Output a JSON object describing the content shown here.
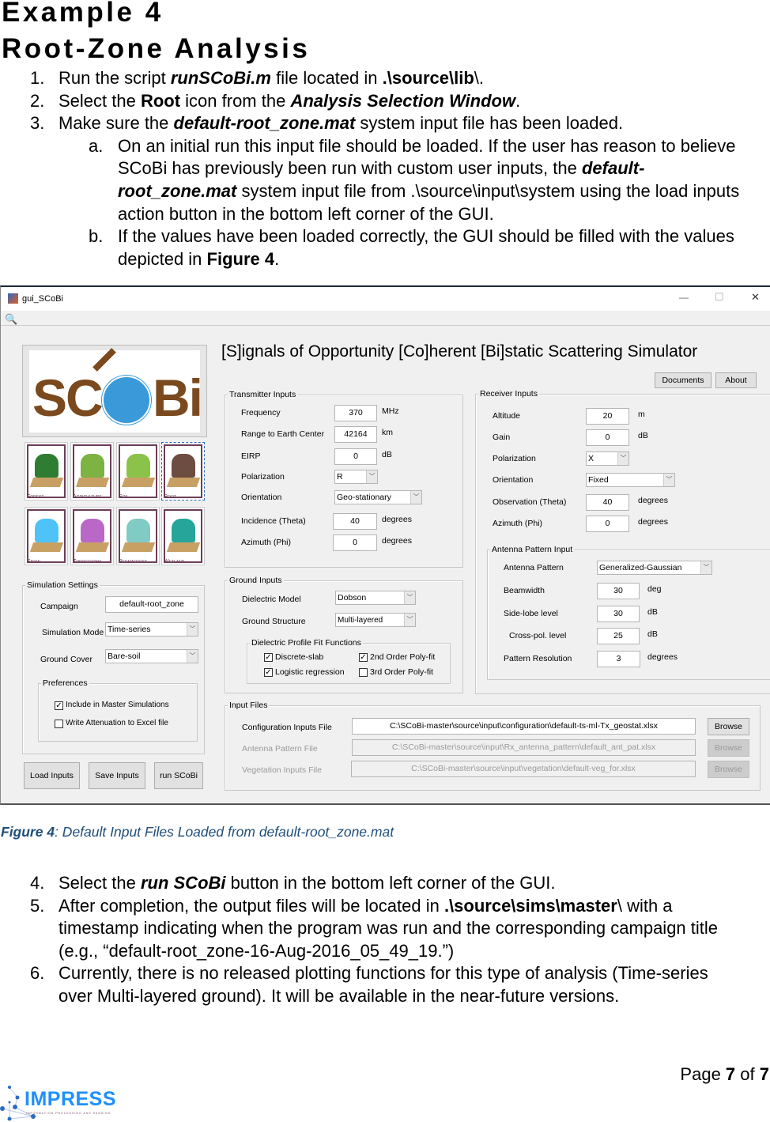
{
  "heading": {
    "line1": "Example 4",
    "line2": "Root-Zone Analysis"
  },
  "steps_top": [
    {
      "n": "1.",
      "parts": [
        "Run the script ",
        "runSCoBi.m",
        " file located in ",
        ".\\source\\lib",
        "\\."
      ]
    },
    {
      "n": "2.",
      "parts": [
        "Select the ",
        "Root",
        " icon from the ",
        "Analysis Selection Window",
        "."
      ]
    },
    {
      "n": "3.",
      "parts": [
        "Make sure the ",
        "default-root_zone.mat",
        " system input file has been loaded."
      ]
    }
  ],
  "substeps": [
    {
      "n": "a.",
      "lines": [
        "On an initial run this input file should be loaded. If the user has reason to believe",
        "SCoBi has previously been run with custom user inputs, the ",
        "default-",
        "root_zone.mat",
        " system input file from .\\source\\input\\system using the load inputs",
        "action button in the bottom left corner of the GUI."
      ]
    },
    {
      "n": "b.",
      "lines": [
        "If the values have been loaded correctly, the GUI should be filled with the values",
        "depicted in ",
        "Figure 4",
        "."
      ]
    }
  ],
  "gui": {
    "window_title": "gui_SCoBi",
    "controls": {
      "minimize": "—",
      "maximize": "☐",
      "close": "✕"
    },
    "app_title": "[S]ignals of Opportunity [Co]herent [Bi]static Scattering Simulator",
    "logo_text": "SCoBi",
    "analysis_icons": [
      "Forest",
      "Agriculture",
      "Soil",
      "Root",
      "Snow",
      "Topography",
      "Permafrost",
      "Wetland"
    ],
    "selected_icon": "Root",
    "buttons": {
      "documents": "Documents",
      "about": "About",
      "load": "Load Inputs",
      "save": "Save Inputs",
      "run": "run SCoBi",
      "browse": "Browse"
    },
    "sim": {
      "title": "Simulation Settings",
      "campaign_label": "Campaign",
      "campaign": "default-root_zone",
      "mode_label": "Simulation Mode",
      "mode": "Time-series",
      "cover_label": "Ground Cover",
      "cover": "Bare-soil",
      "pref_title": "Preferences",
      "pref1": "Include in Master Simulations",
      "pref1_checked": true,
      "pref2": "Write Attenuation to Excel file",
      "pref2_checked": false
    },
    "tx": {
      "title": "Transmitter Inputs",
      "freq_label": "Frequency",
      "freq": "370",
      "freq_unit": "MHz",
      "range_label": "Range to Earth Center",
      "range": "42164",
      "range_unit": "km",
      "eirp_label": "EIRP",
      "eirp": "0",
      "eirp_unit": "dB",
      "pol_label": "Polarization",
      "pol": "R",
      "orient_label": "Orientation",
      "orient": "Geo-stationary",
      "inc_label": "Incidence (Theta)",
      "inc": "40",
      "inc_unit": "degrees",
      "az_label": "Azimuth (Phi)",
      "az": "0",
      "az_unit": "degrees"
    },
    "ground": {
      "title": "Ground Inputs",
      "diel_label": "Dielectric Model",
      "diel": "Dobson",
      "struct_label": "Ground Structure",
      "struct": "Multi-layered",
      "fit_title": "Dielectric Profile Fit Functions",
      "fits": [
        {
          "label": "Discrete-slab",
          "checked": true
        },
        {
          "label": "2nd Order Poly-fit",
          "checked": true
        },
        {
          "label": "Logistic regression",
          "checked": true
        },
        {
          "label": "3rd Order Poly-fit",
          "checked": false
        }
      ]
    },
    "rx": {
      "title": "Receiver Inputs",
      "alt_label": "Altitude",
      "alt": "20",
      "alt_unit": "m",
      "gain_label": "Gain",
      "gain": "0",
      "gain_unit": "dB",
      "pol_label": "Polarization",
      "pol": "X",
      "orient_label": "Orientation",
      "orient": "Fixed",
      "obs_label": "Observation (Theta)",
      "obs": "40",
      "obs_unit": "degrees",
      "az_label": "Azimuth (Phi)",
      "az": "0",
      "az_unit": "degrees",
      "ant_title": "Antenna Pattern Input",
      "pat_label": "Antenna Pattern",
      "pat": "Generalized-Gaussian",
      "bw_label": "Beamwidth",
      "bw": "30",
      "bw_unit": "deg",
      "sl_label": "Side-lobe level",
      "sl": "30",
      "sl_unit": "dB",
      "xp_label": "Cross-pol. level",
      "xp": "25",
      "xp_unit": "dB",
      "res_label": "Pattern Resolution",
      "res": "3",
      "res_unit": "degrees"
    },
    "files": {
      "title": "Input Files",
      "config_label": "Configuration Inputs File",
      "config": "C:\\SCoBi-master\\source\\input\\configuration\\default-ts-ml-Tx_geostat.xlsx",
      "ant_label": "Antenna Pattern File",
      "ant": "C:\\SCoBi-master\\source\\input\\Rx_antenna_pattern\\default_ant_pat.xlsx",
      "veg_label": "Vegetation Inputs File",
      "veg": "C:\\SCoBi-master\\source\\input\\vegetation\\default-veg_for.xlsx"
    }
  },
  "caption": {
    "label": "Figure 4",
    "text": ": Default Input Files Loaded from default-root_zone.mat"
  },
  "steps_bottom": [
    {
      "n": "4.",
      "lines": [
        "Select the ",
        "run SCoBi",
        " button in the bottom left corner of the GUI."
      ]
    },
    {
      "n": "5.",
      "lines": [
        "After completion, the output files will be located in ",
        ".\\source\\sims\\master",
        "\\ with a",
        "timestamp indicating when the program was run and the corresponding campaign title",
        "(e.g., “default-root_zone-16-Aug-2016_05_49_19.”)"
      ]
    },
    {
      "n": "6.",
      "lines": [
        "Currently, there is no released plotting functions for this type of analysis (Time-series",
        "over Multi-layered ground). It will be available in the near-future versions."
      ]
    }
  ],
  "footer": {
    "page_prefix": "Page ",
    "page": "7",
    "of": " of ",
    "total": "7",
    "logo": "IMPRESS",
    "logo_sub": "INFORMATION PROCESSING AND SENSING"
  },
  "colors": {
    "caption": "#1f4e79",
    "logo_blue": "#1e90ff",
    "logo_brown": "#7a4a1e",
    "globe": "#3a9ad9"
  }
}
